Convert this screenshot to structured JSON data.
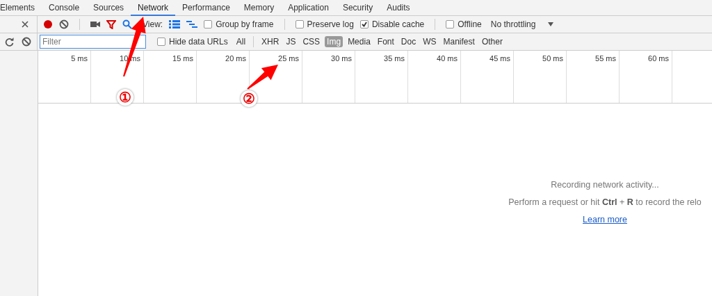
{
  "tabs": [
    {
      "label": "Elements",
      "selected": false
    },
    {
      "label": "Console",
      "selected": false
    },
    {
      "label": "Sources",
      "selected": false
    },
    {
      "label": "Network",
      "selected": true
    },
    {
      "label": "Performance",
      "selected": false
    },
    {
      "label": "Memory",
      "selected": false
    },
    {
      "label": "Application",
      "selected": false
    },
    {
      "label": "Security",
      "selected": false
    },
    {
      "label": "Audits",
      "selected": false
    }
  ],
  "toolbar": {
    "recording": true,
    "filter_shown": true,
    "view_label": "View:",
    "checkboxes": [
      {
        "label": "Group by frame",
        "checked": false
      },
      {
        "label": "Preserve log",
        "checked": false
      },
      {
        "label": "Disable cache",
        "checked": true
      },
      {
        "label": "Offline",
        "checked": false
      }
    ],
    "throttling": "No throttling"
  },
  "filter_bar": {
    "placeholder": "Filter",
    "hide_data_urls": {
      "label": "Hide data URLs",
      "checked": false
    },
    "types": [
      {
        "label": "All",
        "selected": false
      },
      {
        "label": "XHR",
        "selected": false
      },
      {
        "label": "JS",
        "selected": false
      },
      {
        "label": "CSS",
        "selected": false
      },
      {
        "label": "Img",
        "selected": true
      },
      {
        "label": "Media",
        "selected": false
      },
      {
        "label": "Font",
        "selected": false
      },
      {
        "label": "Doc",
        "selected": false
      },
      {
        "label": "WS",
        "selected": false
      },
      {
        "label": "Manifest",
        "selected": false
      },
      {
        "label": "Other",
        "selected": false
      }
    ]
  },
  "timeline_ticks": [
    "5 ms",
    "10 ms",
    "15 ms",
    "20 ms",
    "25 ms",
    "30 ms",
    "35 ms",
    "40 ms",
    "45 ms",
    "50 ms",
    "55 ms",
    "60 ms"
  ],
  "empty_state": {
    "title": "Recording network activity...",
    "hint": "Perform a request or hit **Ctrl** + **R** to record the relo",
    "link": "Learn more"
  },
  "annotations": [
    {
      "label": "①"
    },
    {
      "label": "②"
    }
  ]
}
